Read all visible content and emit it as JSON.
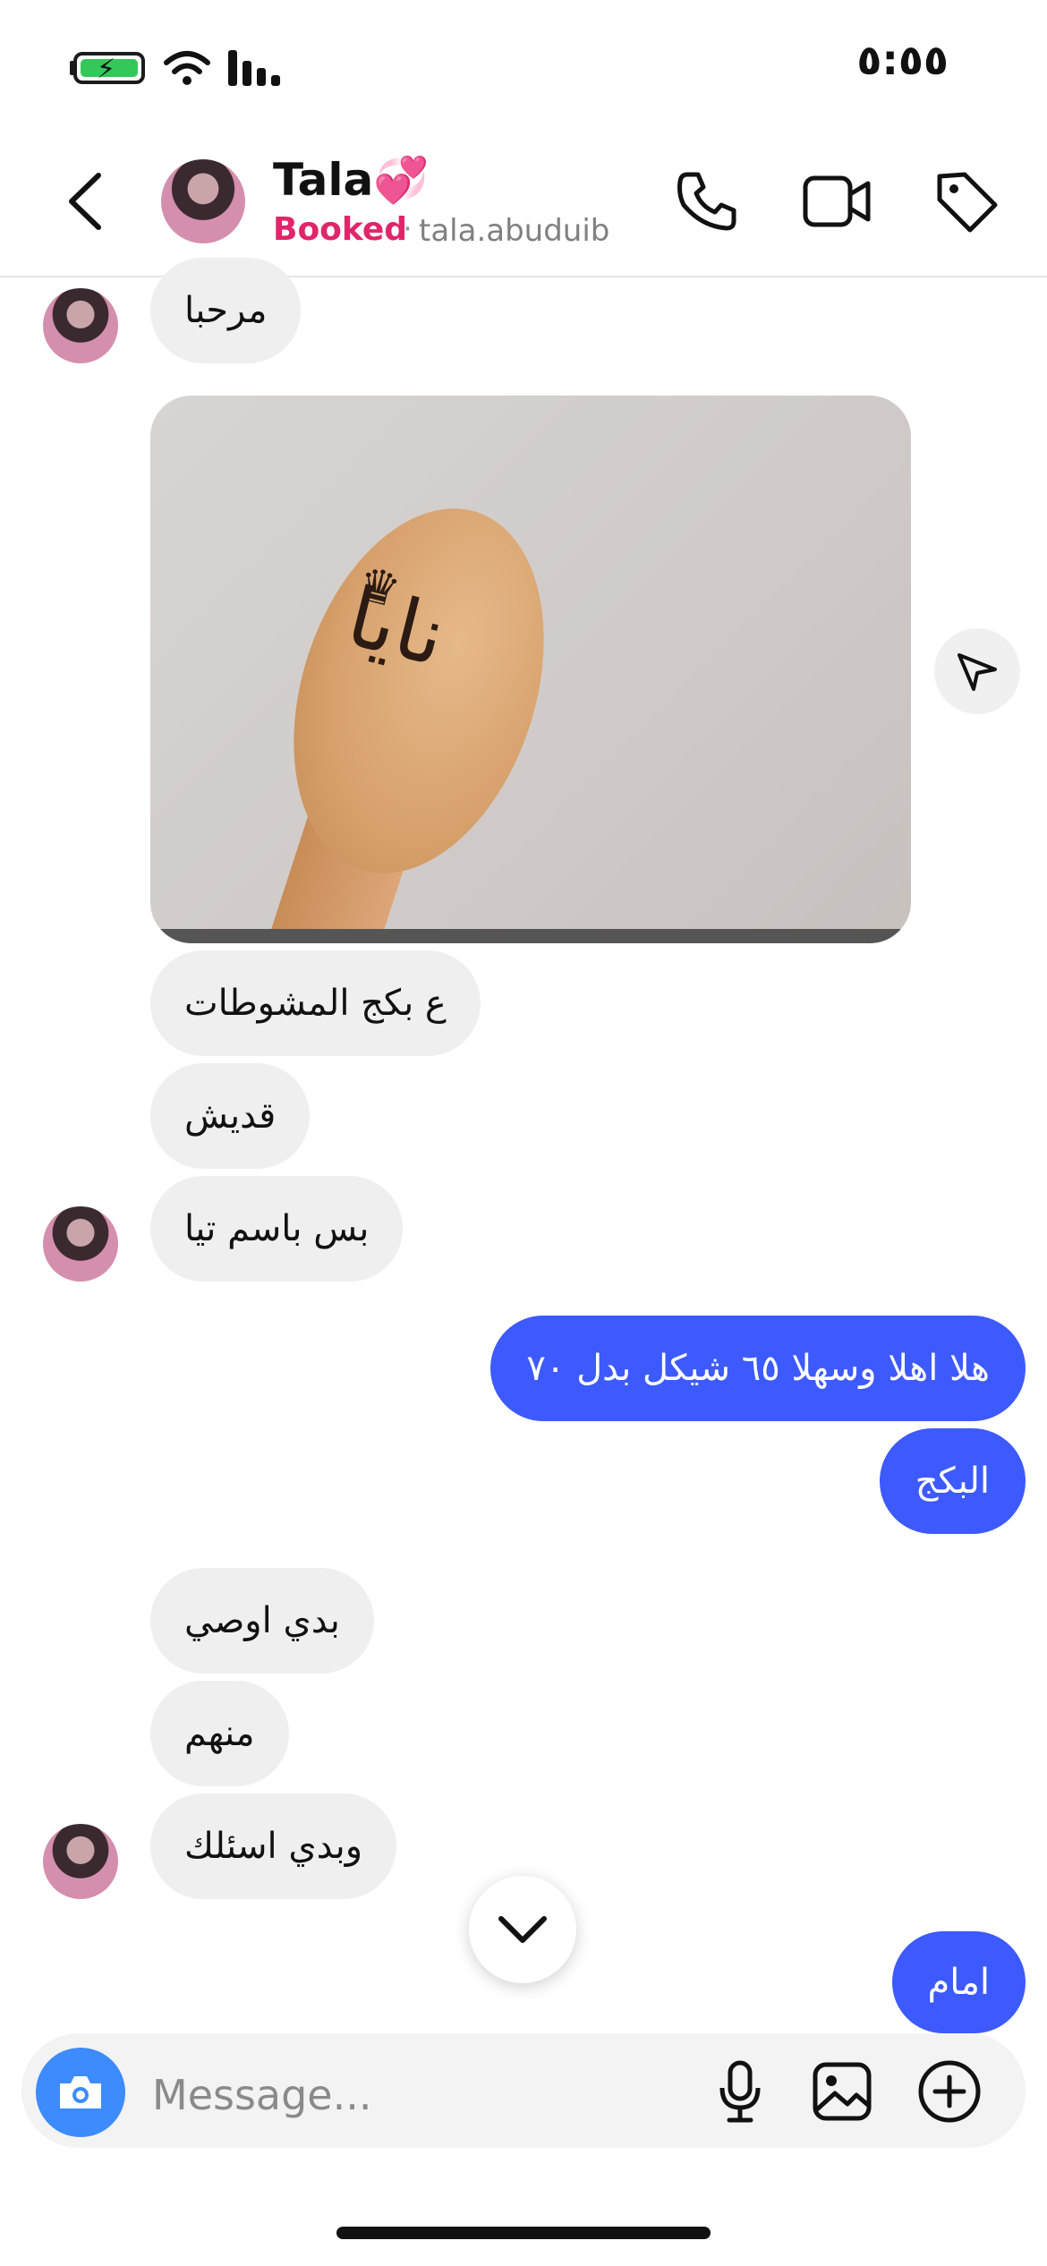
{
  "status_bar": {
    "time": "٥:٥٥",
    "icons": [
      "battery-charging-icon",
      "wifi-icon",
      "signal-icon"
    ]
  },
  "header": {
    "name": "Tala💞",
    "label": "Booked",
    "separator": "·",
    "username": "tala.abuduib",
    "icons": [
      "back-chevron-icon",
      "phone-icon",
      "video-camera-icon",
      "tag-icon"
    ]
  },
  "messages": {
    "incoming_1": "مرحبا",
    "image_text": "نايا",
    "incoming_2": "ع بكج المشوطات",
    "incoming_3": "قديش",
    "incoming_4": "بس باسم تيا",
    "outgoing_1": "هلا اهلا وسهلا ٦٥ شيكل بدل ٧٠",
    "outgoing_2": "البكج",
    "incoming_5": "بدي  اوصي",
    "incoming_6": "منهم",
    "incoming_7": "وبدي اسئلك",
    "outgoing_3": "امام"
  },
  "composer": {
    "placeholder": "Message...",
    "icons": [
      "camera-icon",
      "microphone-icon",
      "gallery-icon",
      "plus-circle-icon"
    ]
  },
  "colors": {
    "accent_blue": "#3d5afe",
    "booked_pink": "#e0266a",
    "bubble_gray": "#efefef"
  }
}
